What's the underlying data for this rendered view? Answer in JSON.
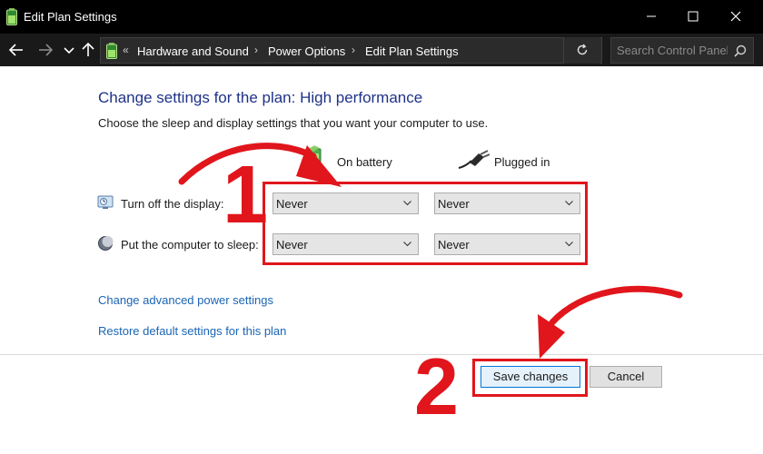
{
  "window": {
    "title": "Edit Plan Settings"
  },
  "address_bar": {
    "crumb_overflow": "«",
    "crumbs": [
      "Hardware and Sound",
      "Power Options",
      "Edit Plan Settings"
    ],
    "separator": "›"
  },
  "search": {
    "placeholder": "Search Control Panel"
  },
  "main": {
    "heading": "Change settings for the plan: High performance",
    "subtext": "Choose the sleep and display settings that you want your computer to use.",
    "columns": {
      "on_battery": "On battery",
      "plugged_in": "Plugged in"
    },
    "rows": [
      {
        "label": "Turn off the display:",
        "on_battery": "Never",
        "plugged_in": "Never"
      },
      {
        "label": "Put the computer to sleep:",
        "on_battery": "Never",
        "plugged_in": "Never"
      }
    ],
    "links": {
      "advanced": "Change advanced power settings",
      "restore": "Restore default settings for this plan"
    },
    "buttons": {
      "save": "Save changes",
      "cancel": "Cancel"
    }
  },
  "annotations": {
    "step1": "1",
    "step2": "2",
    "color": "#e0161c"
  },
  "colors": {
    "titlebar": "#000000",
    "navbar": "#191919",
    "heading": "#1e3287",
    "link": "#1a64b4",
    "save_border": "#0078d7"
  }
}
